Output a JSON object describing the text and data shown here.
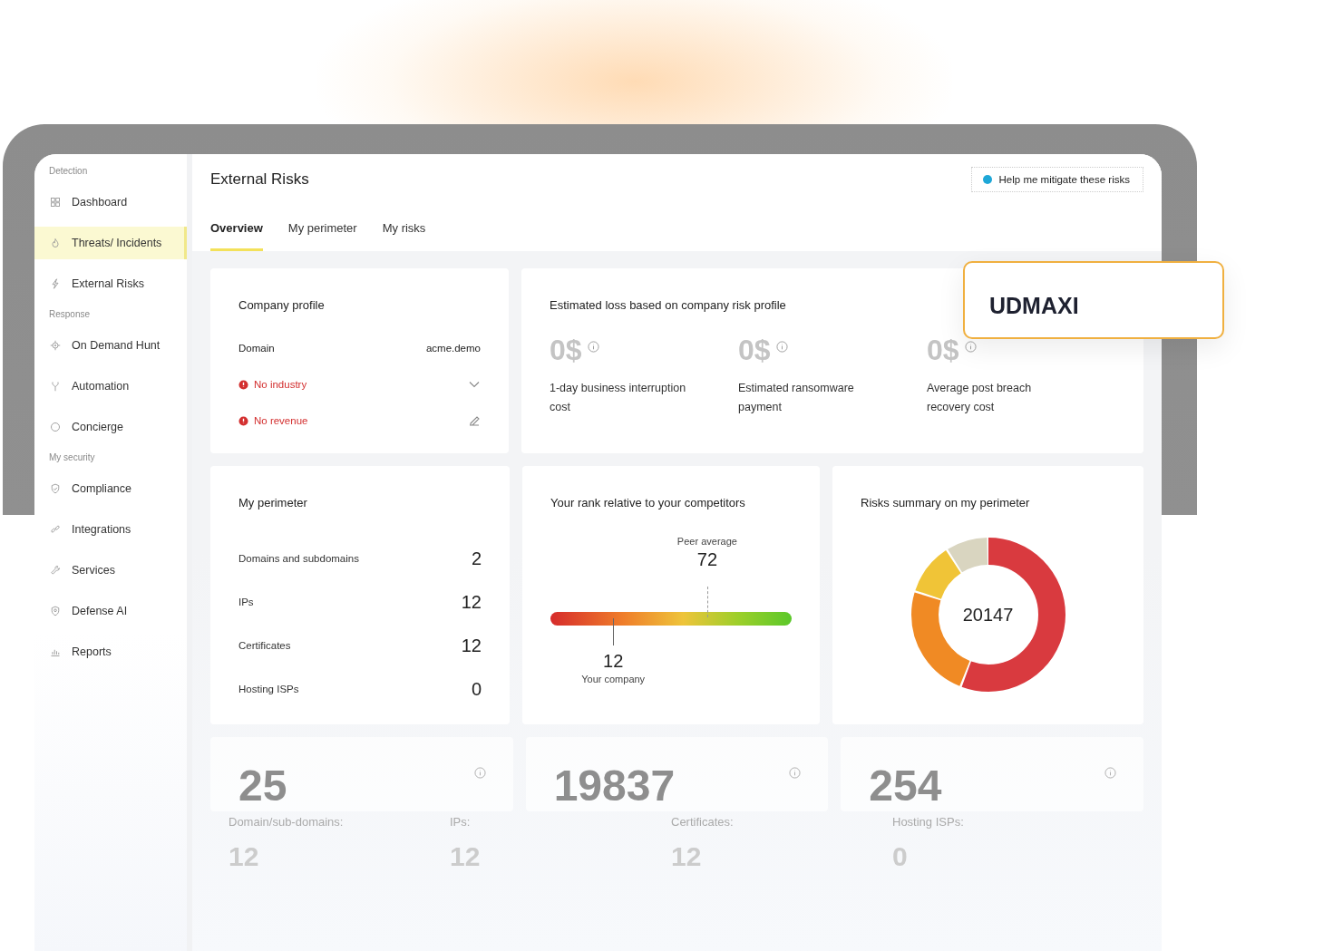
{
  "sidebar": {
    "sections": [
      {
        "label": "Detection",
        "items": [
          {
            "label": "Dashboard",
            "selected": false
          },
          {
            "label": "Threats/ Incidents",
            "selected": true
          },
          {
            "label": "External Risks",
            "selected": false
          }
        ]
      },
      {
        "label": "Response",
        "items": [
          {
            "label": "On Demand Hunt",
            "selected": false
          },
          {
            "label": "Automation",
            "selected": false
          },
          {
            "label": "Concierge",
            "selected": false
          }
        ]
      },
      {
        "label": "My security",
        "items": [
          {
            "label": "Compliance",
            "selected": false
          },
          {
            "label": "Integrations",
            "selected": false
          },
          {
            "label": "Services",
            "selected": false
          },
          {
            "label": "Defense AI",
            "selected": false
          },
          {
            "label": "Reports",
            "selected": false
          }
        ]
      }
    ]
  },
  "header": {
    "title": "External Risks",
    "help_button": "Help me mitigate these risks"
  },
  "tabs": [
    {
      "label": "Overview",
      "selected": true
    },
    {
      "label": "My perimeter",
      "selected": false
    },
    {
      "label": "My risks",
      "selected": false
    }
  ],
  "company_profile": {
    "title": "Company profile",
    "rows": [
      {
        "kind": "text",
        "label": "Domain",
        "value": "acme.demo"
      },
      {
        "kind": "select",
        "label": "No industry"
      },
      {
        "kind": "editable",
        "label": "No revenue"
      }
    ]
  },
  "estimated_loss": {
    "title": "Estimated loss based on company risk profile",
    "items": [
      {
        "value": "0$",
        "label": "1-day business interruption cost"
      },
      {
        "value": "0$",
        "label": "Estimated ransomware payment"
      },
      {
        "value": "0$",
        "label": "Average post breach recovery cost"
      }
    ]
  },
  "perimeter": {
    "title": "My perimeter",
    "rows": [
      {
        "label": "Domains and subdomains",
        "value": "2"
      },
      {
        "label": "IPs",
        "value": "12"
      },
      {
        "label": "Certificates",
        "value": "12"
      },
      {
        "label": "Hosting ISPs",
        "value": "0"
      }
    ]
  },
  "rank": {
    "title": "Your rank relative to your competitors",
    "peer": {
      "label": "Peer average",
      "value": "72",
      "level": 0.65
    },
    "company": {
      "label": "Your company",
      "value": "12",
      "level": 0.26
    }
  },
  "risks_summary": {
    "title": "Risks summary on my perimeter",
    "total": "20147"
  },
  "totals": [
    {
      "value": "25"
    },
    {
      "value": "19837"
    },
    {
      "value": "254"
    }
  ],
  "stats": [
    {
      "label": "Domain/sub-domains:",
      "value": "12"
    },
    {
      "label": "IPs:",
      "value": "12"
    },
    {
      "label": "Certificates:",
      "value": "12"
    },
    {
      "label": "Hosting ISPs:",
      "value": "0"
    }
  ],
  "overlay_card": {
    "text": "UDMAXI"
  }
}
